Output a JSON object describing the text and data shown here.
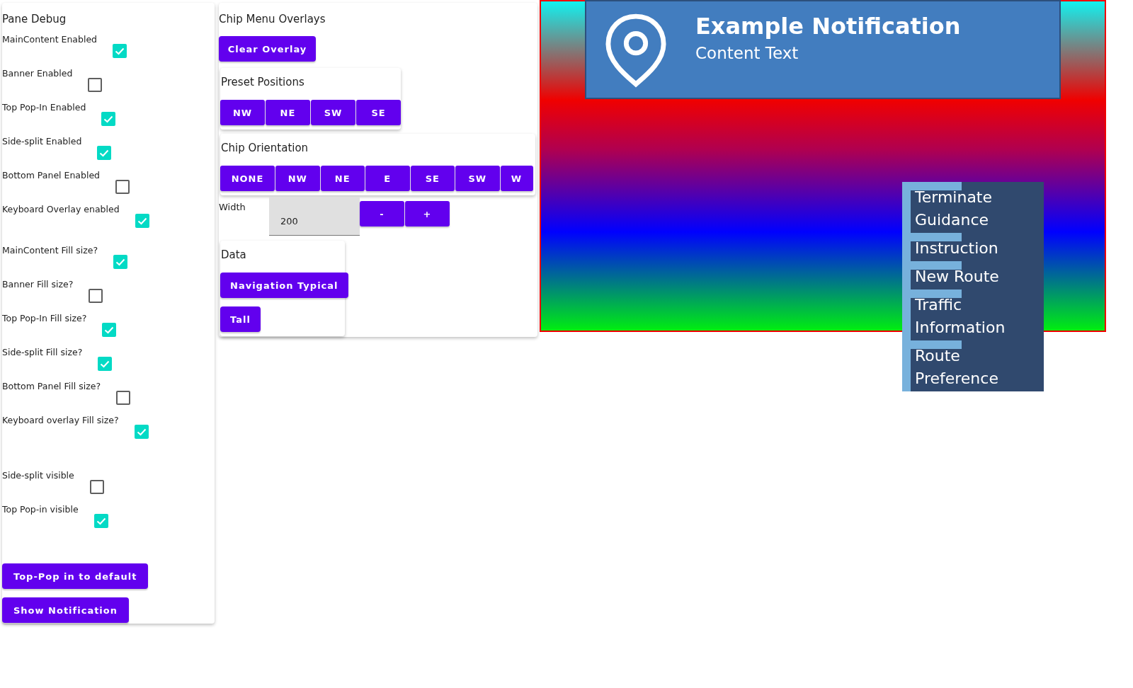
{
  "pane_debug": {
    "title": "Pane Debug",
    "groups": [
      [
        {
          "label": "MainContent Enabled",
          "checked": true
        },
        {
          "label": "Banner Enabled",
          "checked": false
        },
        {
          "label": "Top Pop-In Enabled",
          "checked": true
        },
        {
          "label": "Side-split Enabled",
          "checked": true
        },
        {
          "label": "Bottom Panel Enabled",
          "checked": false
        },
        {
          "label": "Keyboard Overlay enabled",
          "checked": true
        }
      ],
      [
        {
          "label": "MainContent Fill size?",
          "checked": true
        },
        {
          "label": "Banner Fill size?",
          "checked": false
        },
        {
          "label": "Top Pop-In Fill size?",
          "checked": true
        },
        {
          "label": "Side-split Fill size?",
          "checked": true
        },
        {
          "label": "Bottom Panel Fill size?",
          "checked": false
        },
        {
          "label": "Keyboard overlay Fill size?",
          "checked": true
        }
      ],
      [
        {
          "label": "Side-split visible",
          "checked": false
        },
        {
          "label": "Top Pop-in visible",
          "checked": true
        }
      ]
    ],
    "buttons": [
      "Top-Pop in to default",
      "Show Notification"
    ]
  },
  "chip_menu_overlays": {
    "title": "Chip Menu Overlays",
    "clear_button": "Clear Overlay",
    "preset_positions": {
      "title": "Preset Positions",
      "buttons": [
        "NW",
        "NE",
        "SW",
        "SE"
      ]
    },
    "chip_orientation": {
      "title": "Chip Orientation",
      "buttons": [
        "NONE",
        "NW",
        "NE",
        "E",
        "SE",
        "SW",
        "W"
      ]
    },
    "width": {
      "label": "Width",
      "value": "200",
      "buttons": [
        "-",
        "+"
      ]
    },
    "data": {
      "title": "Data",
      "buttons": [
        "Navigation Typical",
        "Tall"
      ]
    }
  },
  "notification": {
    "title": "Example Notification",
    "content": "Content Text"
  },
  "chip_menu": {
    "items": [
      "Terminate Guidance",
      "Instruction",
      "New Route",
      "Traffic Information",
      "Route Preference"
    ]
  }
}
